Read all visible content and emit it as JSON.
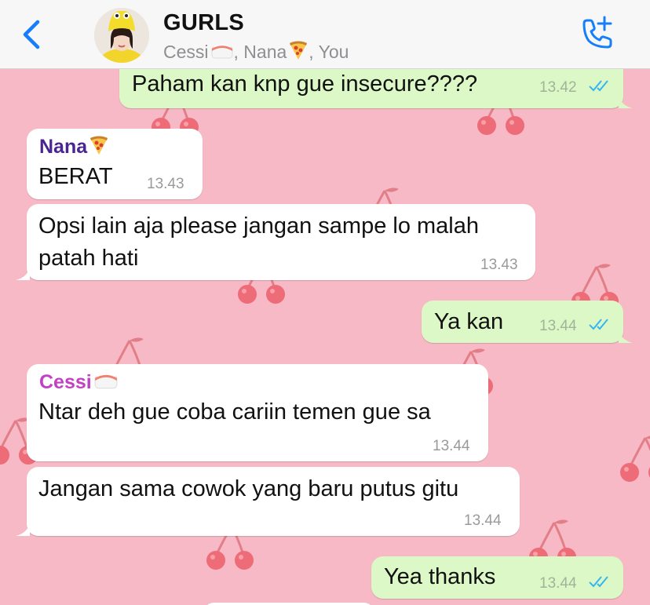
{
  "header": {
    "back_icon": "chevron-left-icon",
    "title": "GURLS",
    "subtitle": {
      "member1": "Cessi",
      "member1_emoji": "sushi-emoji",
      "sep1": ", ",
      "member2": "Nana",
      "member2_emoji": "pizza-emoji",
      "sep2": ", ",
      "member3": "You"
    },
    "call_icon": "add-call-icon"
  },
  "colors": {
    "accent": "#147efb",
    "wallpaper": "#f7b9c6",
    "outgoing_bubble": "#dcf8c6",
    "incoming_bubble": "#ffffff",
    "nana_name": "#4a2592",
    "cessi_name": "#c33fc4"
  },
  "messages": [
    {
      "text": "Paham kan knp gue insecure????",
      "time": "13.42"
    },
    {
      "sender": "Nana",
      "sender_emoji": "pizza-emoji",
      "text": "BERAT",
      "time": "13.43"
    },
    {
      "line1": "Opsi lain aja please jangan sampe lo malah",
      "line2": "patah hati",
      "time": "13.43"
    },
    {
      "text": "Ya kan",
      "time": "13.44"
    },
    {
      "sender": "Cessi",
      "sender_emoji": "sushi-emoji",
      "text": "Ntar deh gue coba cariin temen gue sa",
      "time": "13.44"
    },
    {
      "text": "Jangan sama cowok yang baru putus gitu",
      "time": "13.44"
    },
    {
      "text": "Yea thanks",
      "time": "13.44"
    }
  ]
}
